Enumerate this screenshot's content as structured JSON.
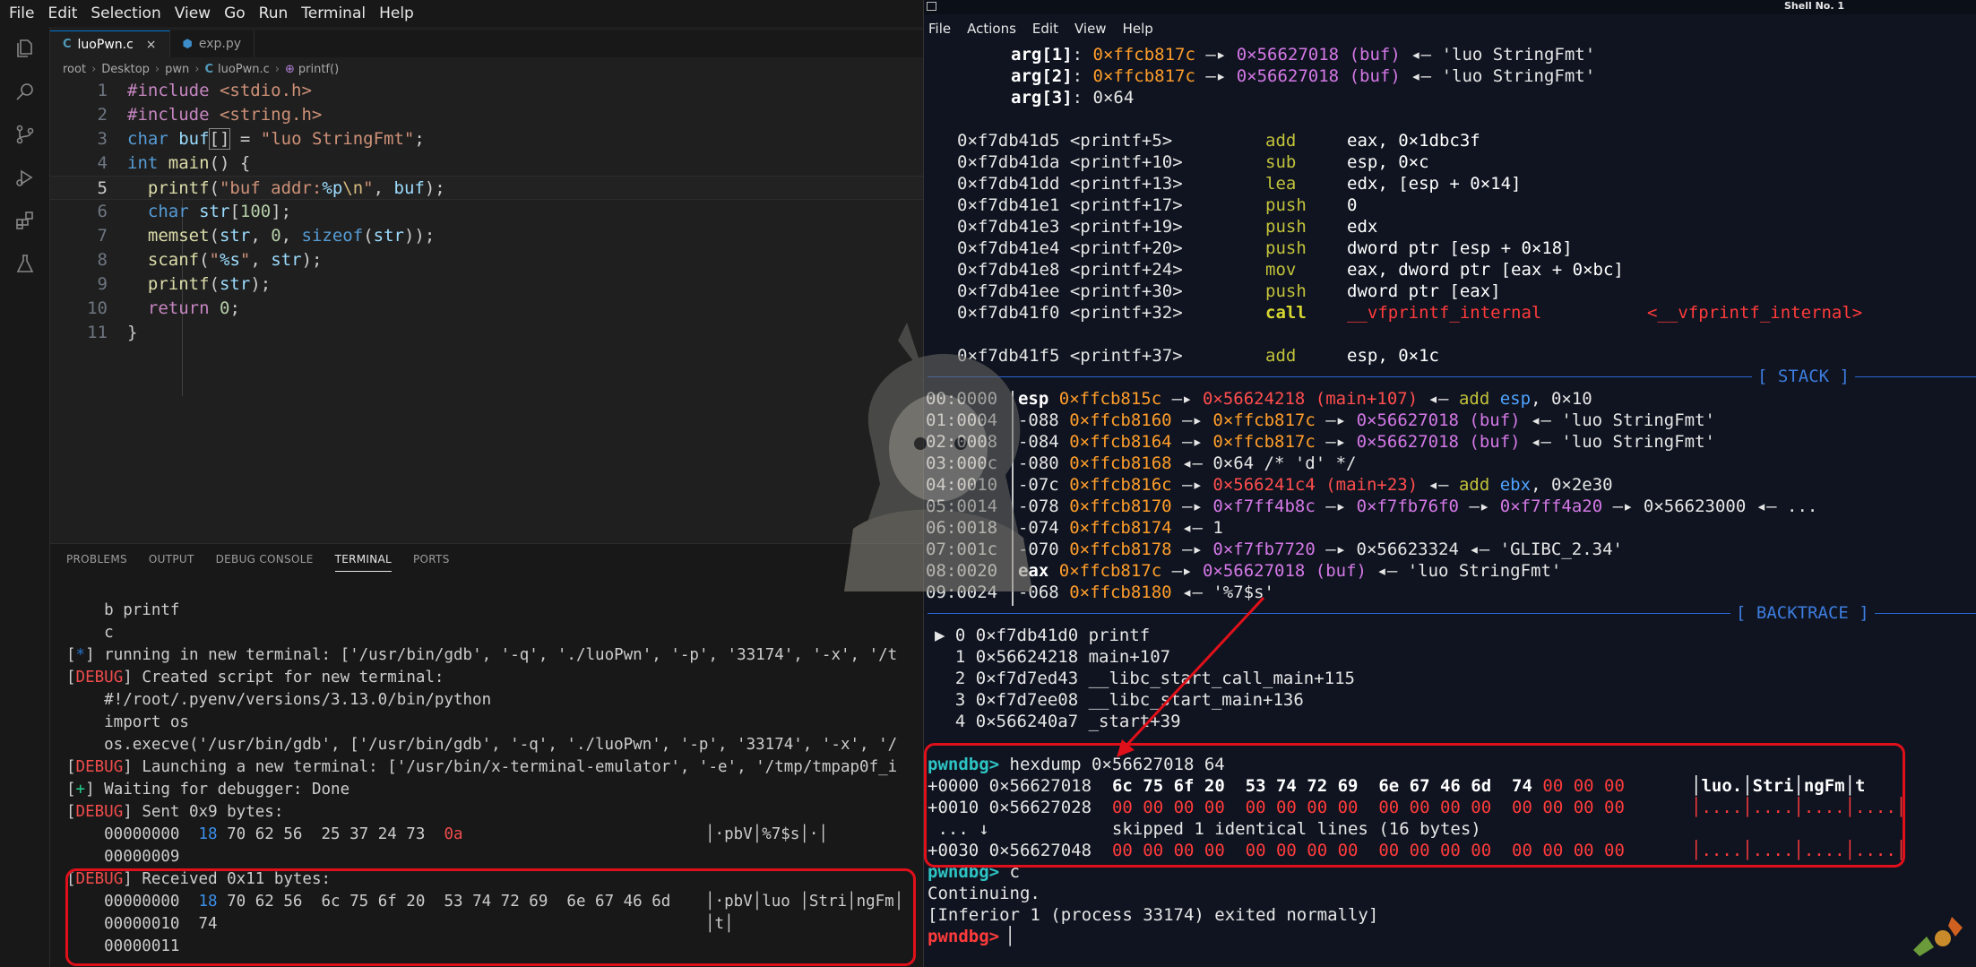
{
  "vscode": {
    "menu": [
      "File",
      "Edit",
      "Selection",
      "View",
      "Go",
      "Run",
      "Terminal",
      "Help"
    ],
    "tabs": [
      {
        "icon": "C",
        "label": "luoPwn.c",
        "close": "×"
      },
      {
        "icon": "⬢",
        "label": "exp.py"
      }
    ],
    "breadcrumb": [
      "root",
      "Desktop",
      "pwn",
      "luoPwn.c",
      "printf()"
    ],
    "code_lines": [
      {
        "n": "1"
      },
      {
        "n": "2"
      },
      {
        "n": "3"
      },
      {
        "n": "4"
      },
      {
        "n": "5"
      },
      {
        "n": "6"
      },
      {
        "n": "7"
      },
      {
        "n": "8"
      },
      {
        "n": "9"
      },
      {
        "n": "10"
      },
      {
        "n": "11"
      }
    ],
    "panel_tabs": [
      "PROBLEMS",
      "OUTPUT",
      "DEBUG CONSOLE",
      "TERMINAL",
      "PORTS"
    ],
    "terminal": {
      "l1": "    b printf",
      "l2": "    c",
      "l3_tag": "*",
      "l3": " running in new terminal: ['/usr/bin/gdb', '-q', './luoPwn', '-p', '33174', '-x', '/t",
      "l4_tag": "DEBUG",
      "l4": " Created script for new terminal:",
      "l5": "    #!/root/.pyenv/versions/3.13.0/bin/python",
      "l6": "    import os",
      "l7": "    os.execve('/usr/bin/gdb', ['/usr/bin/gdb', '-q', './luoPwn', '-p', '33174', '-x', '/",
      "l8_tag": "DEBUG",
      "l8": " Launching a new terminal: ['/usr/bin/x-terminal-emulator', '-e', '/tmp/tmpap0f_i",
      "l9_tag": "+",
      "l9": " Waiting for debugger: Done",
      "l10_tag": "DEBUG",
      "l10": " Sent 0x9 bytes:",
      "l11_off": "    00000000",
      "l11_hex1": "18",
      "l11_hex2": " 70 62 56  25 37 24 73  ",
      "l11_hex3": "0a",
      "l11_asc": "│·pbV│%7$s│·│",
      "l12": "    00000009",
      "l13_tag": "DEBUG",
      "l13": " Received 0x11 bytes:",
      "l14_off": "    00000000",
      "l14_hex1": "18",
      "l14_hex2": " 70 62 56  6c 75 6f 20  53 74 72 69  6e 67 46 6d",
      "l14_asc": "│·pbV│luo │Stri│ngFm│",
      "l15": "    00000010  74",
      "l15_asc": "│t│",
      "l16": "    00000011"
    }
  },
  "shell": {
    "title": "Shell No. 1",
    "menu": [
      "File",
      "Actions",
      "Edit",
      "View",
      "Help"
    ],
    "args": [
      {
        "name": "arg[1]",
        "a": "0×ffcb817c",
        "b": "0×56627018",
        "sym": "(buf)",
        "str": "'luo StringFmt'"
      },
      {
        "name": "arg[2]",
        "a": "0×ffcb817c",
        "b": "0×56627018",
        "sym": "(buf)",
        "str": "'luo StringFmt'"
      },
      {
        "name": "arg[3]",
        "val": "0×64"
      }
    ],
    "disasm": [
      {
        "addr": "0×f7db41d5 <printf+5>",
        "op": "add",
        "args": "eax, 0×1dbc3f"
      },
      {
        "addr": "0×f7db41da <printf+10>",
        "op": "sub",
        "args": "esp, 0×c"
      },
      {
        "addr": "0×f7db41dd <printf+13>",
        "op": "lea",
        "args": "edx, [esp + 0×14]"
      },
      {
        "addr": "0×f7db41e1 <printf+17>",
        "op": "push",
        "args": "0"
      },
      {
        "addr": "0×f7db41e3 <printf+19>",
        "op": "push",
        "args": "edx"
      },
      {
        "addr": "0×f7db41e4 <printf+20>",
        "op": "push",
        "args": "dword ptr [esp + 0×18]"
      },
      {
        "addr": "0×f7db41e8 <printf+24>",
        "op": "mov",
        "args": "eax, dword ptr [eax + 0×bc]"
      },
      {
        "addr": "0×f7db41ee <printf+30>",
        "op": "push",
        "args": "dword ptr [eax]"
      },
      {
        "addr": "0×f7db41f0 <printf+32>",
        "op": "call",
        "args": "__vfprintf_internal",
        "target": "<__vfprintf_internal>"
      },
      {
        "addr": "0×f7db41f5 <printf+37>",
        "op": "add",
        "args": "esp, 0×1c"
      }
    ],
    "stack_label": "[ STACK ]",
    "backtrace_label": "[ BACKTRACE ]",
    "backtrace": [
      "▶ 0 0×f7db41d0 printf",
      "  1 0×56624218 main+107",
      "  2 0×f7d7ed43 __libc_start_call_main+115",
      "  3 0×f7d7ee08 __libc_start_main+136",
      "  4 0×566240a7 _start+39"
    ],
    "prompt": "pwndbg>",
    "hexdump_cmd": " hexdump 0×56627018 64",
    "continue_cmd": " c",
    "continuing": "Continuing.",
    "exited": "[Inferior 1 (process 33174) exited normally]",
    "dump_rows": [
      {
        "off": "+0000",
        "addr": "0×56627018",
        "hex": "6c 75 6f 20  53 74 72 69  6e 67 46 6d  74",
        "zeros": " 00 00 00",
        "asc": "│luo.│Stri│ngFm│t"
      },
      {
        "off": "+0010",
        "addr": "0×56627028",
        "hex": "",
        "zeros": "00 00 00 00  00 00 00 00  00 00 00 00  00 00 00 00",
        "asc": "│....│....│....│....│"
      },
      {
        "off": "+0030",
        "addr": "0×56627048",
        "hex": "",
        "zeros": "00 00 00 00  00 00 00 00  00 00 00 00  00 00 00 00",
        "asc": "│....│....│....│....│"
      }
    ],
    "skipped": " ... ↓            skipped 1 identical lines (16 bytes)"
  }
}
